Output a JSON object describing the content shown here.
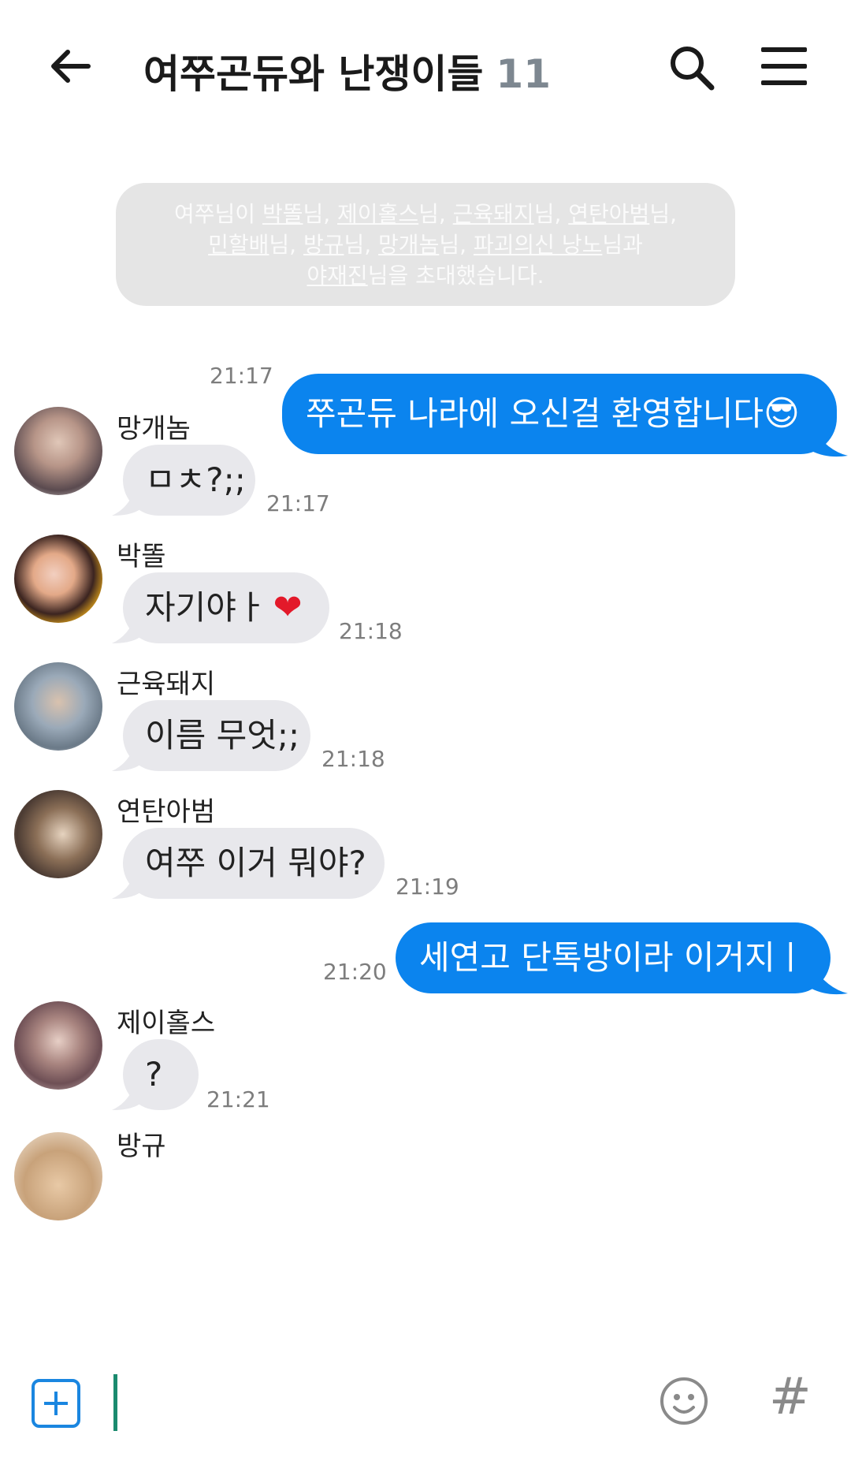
{
  "header": {
    "title": "여쭈곤듀와 난쟁이들",
    "member_count": "11"
  },
  "system_message": {
    "parts": [
      {
        "t": "여쭈님이 "
      },
      {
        "t": "박똘",
        "u": true
      },
      {
        "t": "님, "
      },
      {
        "t": "제이홀스",
        "u": true
      },
      {
        "t": "님, "
      },
      {
        "t": "근육돼지",
        "u": true
      },
      {
        "t": "님, "
      },
      {
        "t": "연탄아범",
        "u": true
      },
      {
        "t": "님,"
      },
      {
        "br": true
      },
      {
        "t": "민할배",
        "u": true
      },
      {
        "t": "님, "
      },
      {
        "t": "방규",
        "u": true
      },
      {
        "t": "님, "
      },
      {
        "t": "망개놈",
        "u": true
      },
      {
        "t": "님, "
      },
      {
        "t": "파괴의신 낭노",
        "u": true
      },
      {
        "t": "님과"
      },
      {
        "br": true
      },
      {
        "t": "야재진",
        "u": true
      },
      {
        "t": "님을 초대했습니다."
      }
    ]
  },
  "messages": [
    {
      "sender": "me",
      "text": "쭈곤듀 나라에 오신걸 환영합니다",
      "emoji": "😎",
      "time": "21:17"
    },
    {
      "sender": "망개놈",
      "text": "ㅁㅊ?;;",
      "time": "21:17"
    },
    {
      "sender": "박똘",
      "text": "자기야ㅏ",
      "emoji": "❤",
      "time": "21:18"
    },
    {
      "sender": "근육돼지",
      "text": "이름 무엇;;",
      "time": "21:18"
    },
    {
      "sender": "연탄아범",
      "text": "여쭈 이거 뭐야?",
      "time": "21:19"
    },
    {
      "sender": "me",
      "text": "세연고 단톡방이라 이거지ㅣ",
      "time": "21:20"
    },
    {
      "sender": "제이홀스",
      "text": "?",
      "time": "21:21"
    },
    {
      "sender": "방규",
      "text": "",
      "time": ""
    }
  ],
  "input": {
    "placeholder": ""
  },
  "icons": {
    "back": "arrow-left-icon",
    "search": "search-icon",
    "menu": "hamburger-menu-icon",
    "add": "plus-square-icon",
    "emoji": "smiley-icon",
    "hashtag": "hashtag-icon"
  },
  "colors": {
    "my_bubble": "#0b84ee",
    "their_bubble": "#e8e8ec",
    "system_bg": "#e5e5e5",
    "accent": "#1a86e0",
    "cursor": "#1a8a6e"
  }
}
